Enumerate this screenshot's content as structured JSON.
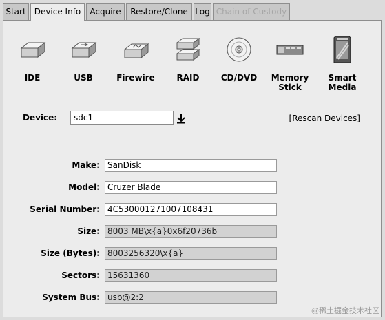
{
  "tabs": [
    {
      "label": "Start",
      "state": "normal"
    },
    {
      "label": "Device Info",
      "state": "active"
    },
    {
      "label": "Acquire",
      "state": "normal"
    },
    {
      "label": "Restore/Clone",
      "state": "normal"
    },
    {
      "label": "Log",
      "state": "normal"
    },
    {
      "label": "Chain of Custody",
      "state": "disabled"
    }
  ],
  "device_types": [
    {
      "label": "IDE",
      "icon": "ide-drive-icon"
    },
    {
      "label": "USB",
      "icon": "usb-drive-icon"
    },
    {
      "label": "Firewire",
      "icon": "firewire-drive-icon"
    },
    {
      "label": "RAID",
      "icon": "raid-drive-icon"
    },
    {
      "label": "CD/DVD",
      "icon": "cd-dvd-icon"
    },
    {
      "label": "Memory\nStick",
      "icon": "memory-stick-icon"
    },
    {
      "label": "Smart\nMedia",
      "icon": "smart-media-icon"
    }
  ],
  "device": {
    "label": "Device:",
    "value": "sdc1",
    "rescan_label": "[Rescan Devices]"
  },
  "info": {
    "make": {
      "label": "Make:",
      "value": "SanDisk"
    },
    "model": {
      "label": "Model:",
      "value": "Cruzer Blade"
    },
    "serial": {
      "label": "Serial Number:",
      "value": "4C530001271007108431"
    },
    "size": {
      "label": "Size:",
      "value": "8003 MB\\x{a}0x6f20736b"
    },
    "size_bytes": {
      "label": "Size (Bytes):",
      "value": "8003256320\\x{a}"
    },
    "sectors": {
      "label": "Sectors:",
      "value": "15631360"
    },
    "system_bus": {
      "label": "System Bus:",
      "value": "usb@2:2"
    }
  },
  "watermark": "@稀土掘金技术社区",
  "colors": {
    "panel": "#ececec",
    "background": "#dcdcdc",
    "readonly_field": "#d2d2d2"
  }
}
